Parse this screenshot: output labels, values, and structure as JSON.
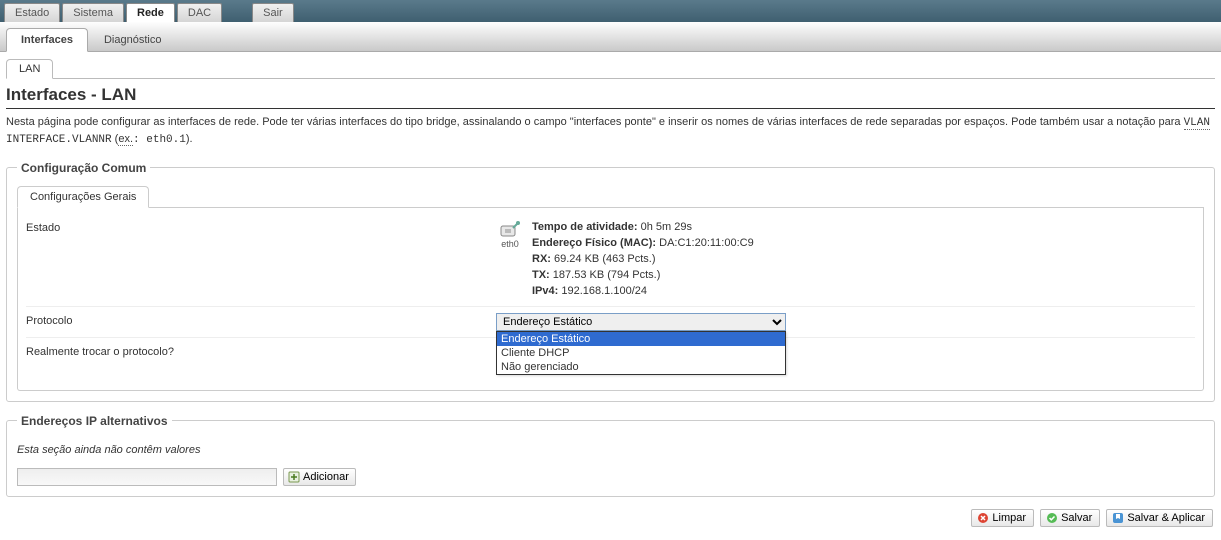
{
  "topnav": {
    "items": [
      {
        "label": "Estado"
      },
      {
        "label": "Sistema"
      },
      {
        "label": "Rede"
      },
      {
        "label": "DAC"
      },
      {
        "label": "Sair"
      }
    ],
    "active_index": 2
  },
  "subnav": {
    "items": [
      {
        "label": "Interfaces"
      },
      {
        "label": "Diagnóstico"
      }
    ],
    "active_index": 0
  },
  "iface_tabs": {
    "items": [
      {
        "label": "LAN"
      }
    ],
    "active_index": 0
  },
  "page": {
    "title": "Interfaces - LAN",
    "desc_part1": "Nesta página pode configurar as interfaces de rede. Pode ter várias interfaces do tipo bridge, assinalando o campo \"interfaces ponte\" e inserir os nomes de várias interfaces de rede separadas por espaços. Pode também usar a notação para ",
    "desc_tt1": "VLAN",
    "desc_tt2": " INTERFACE.VLANNR",
    "desc_ex_open": " (",
    "desc_ex_abbr": "ex.",
    "desc_ex_val": ": eth0.1",
    "desc_ex_close": ")."
  },
  "fieldset_common": {
    "legend": "Configuração Comum",
    "tab_label": "Configurações Gerais",
    "estado_label": "Estado",
    "iface_name": "eth0",
    "info": {
      "uptime_k": "Tempo de atividade:",
      "uptime_v": " 0h 5m 29s",
      "mac_k": "Endereço Físico (MAC):",
      "mac_v": " DA:C1:20:11:00:C9",
      "rx_k": "RX:",
      "rx_v": " 69.24 KB (463 Pcts.)",
      "tx_k": "TX:",
      "tx_v": " 187.53 KB (794 Pcts.)",
      "ipv4_k": "IPv4:",
      "ipv4_v": " 192.168.1.100/24"
    },
    "protocolo_label": "Protocolo",
    "protocolo_selected": "Endereço Estático",
    "protocolo_options": [
      "Endereço Estático",
      "Cliente DHCP",
      "Não gerenciado"
    ],
    "switch_label": "Realmente trocar o protocolo?"
  },
  "alt_ips": {
    "legend": "Endereços IP alternativos",
    "empty_text": "Esta seção ainda não contêm valores",
    "add_label": "Adicionar"
  },
  "actions": {
    "reset": "Limpar",
    "save": "Salvar",
    "save_apply": "Salvar & Aplicar"
  }
}
